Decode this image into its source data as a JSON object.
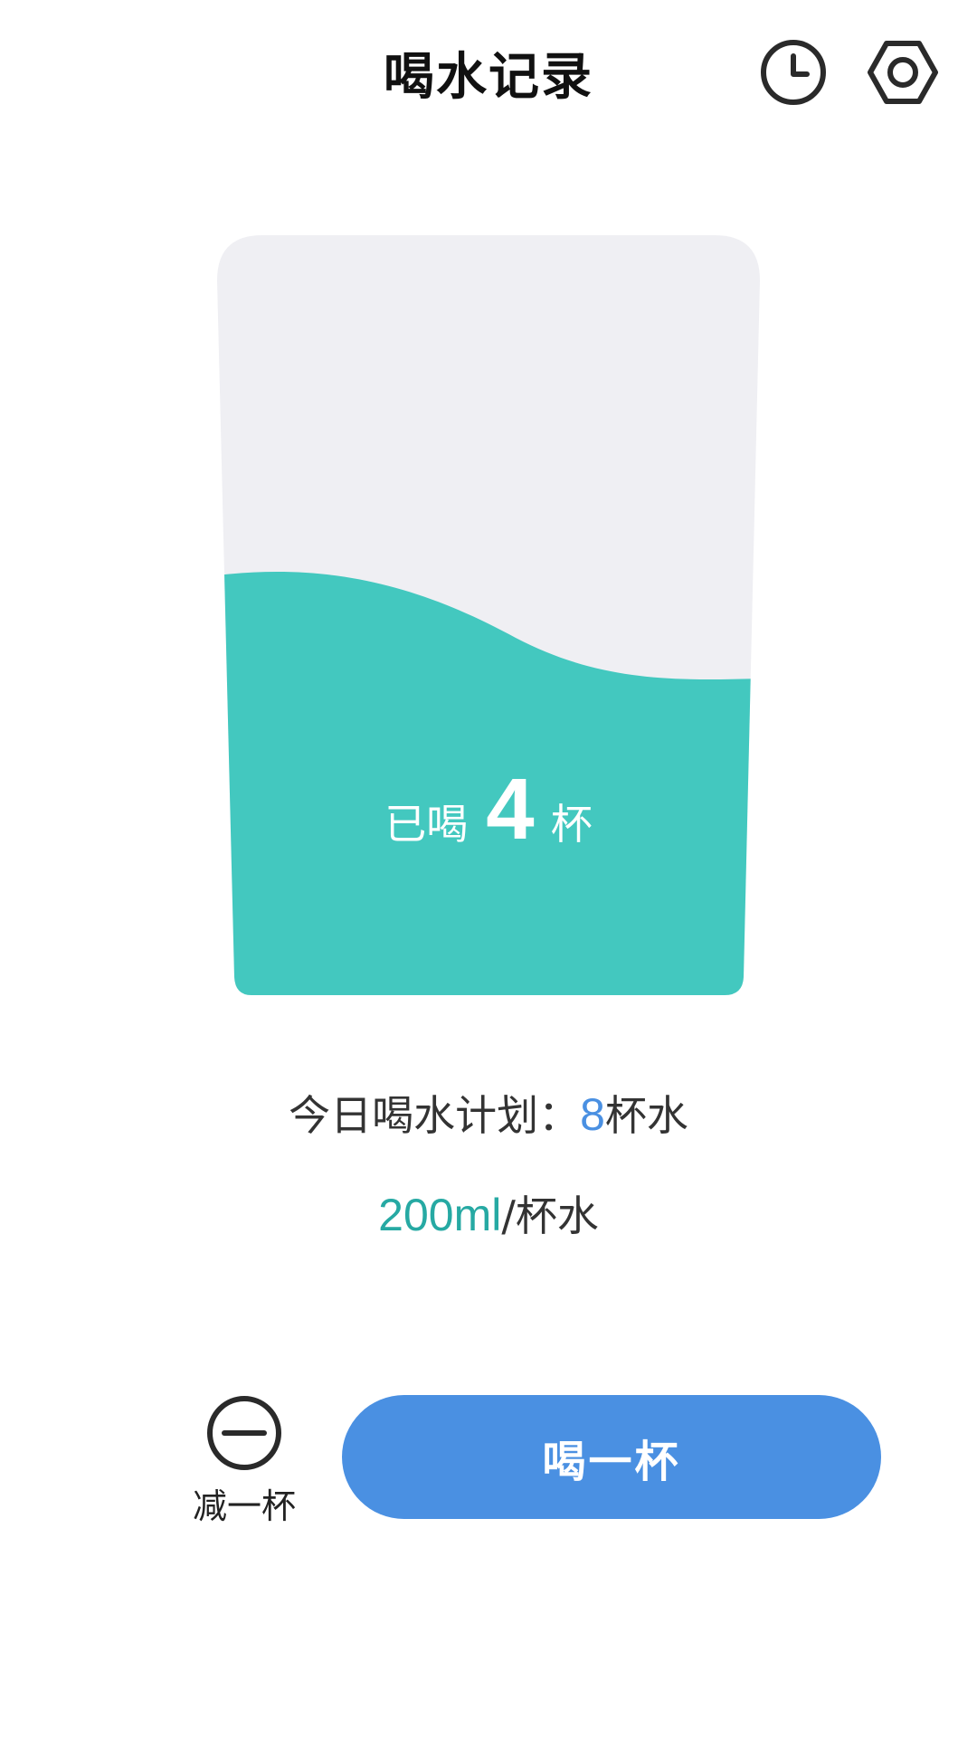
{
  "header": {
    "title": "喝水记录",
    "history_icon": "clock-icon",
    "settings_icon": "hexagon-gear-icon"
  },
  "cup": {
    "prefix": "已喝",
    "count": "4",
    "suffix": "杯",
    "fill_fraction": 0.5,
    "water_color": "#43c8bf",
    "empty_color": "#efeff3"
  },
  "plan": {
    "label": "今日喝水计划：",
    "cups": "8",
    "unit": "杯水"
  },
  "per_cup": {
    "volume": "200ml",
    "unit": "/杯水"
  },
  "actions": {
    "minus_icon": "minus-circle-icon",
    "minus_label": "减一杯",
    "drink_label": "喝一杯"
  },
  "colors": {
    "accent_blue": "#4a90e2",
    "accent_teal": "#26a9a3"
  }
}
